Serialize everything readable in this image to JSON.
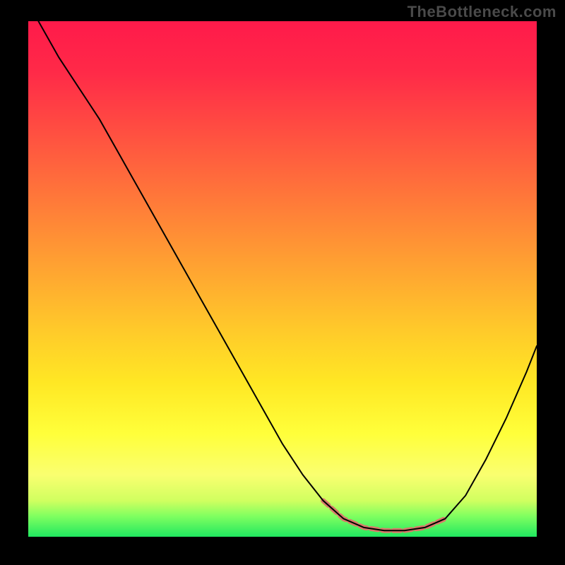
{
  "watermark": "TheBottleneck.com",
  "chart_data": {
    "type": "line",
    "title": "",
    "xlabel": "",
    "ylabel": "",
    "xlim": [
      0,
      100
    ],
    "ylim": [
      0,
      100
    ],
    "gradient_stops": [
      {
        "offset": 0,
        "color": "#ff1a4a"
      },
      {
        "offset": 10,
        "color": "#ff2a48"
      },
      {
        "offset": 20,
        "color": "#ff4a42"
      },
      {
        "offset": 30,
        "color": "#ff6a3c"
      },
      {
        "offset": 40,
        "color": "#ff8a36"
      },
      {
        "offset": 50,
        "color": "#ffaa30"
      },
      {
        "offset": 60,
        "color": "#ffca2a"
      },
      {
        "offset": 70,
        "color": "#ffe724"
      },
      {
        "offset": 80,
        "color": "#ffff3a"
      },
      {
        "offset": 88,
        "color": "#faff70"
      },
      {
        "offset": 93,
        "color": "#d0ff60"
      },
      {
        "offset": 96,
        "color": "#80ff60"
      },
      {
        "offset": 100,
        "color": "#20e860"
      }
    ],
    "series": [
      {
        "name": "curve",
        "color": "#000000",
        "width": 2,
        "points": [
          {
            "x": 2,
            "y": 100
          },
          {
            "x": 6,
            "y": 93
          },
          {
            "x": 10,
            "y": 87
          },
          {
            "x": 14,
            "y": 81
          },
          {
            "x": 18,
            "y": 74
          },
          {
            "x": 22,
            "y": 67
          },
          {
            "x": 26,
            "y": 60
          },
          {
            "x": 30,
            "y": 53
          },
          {
            "x": 34,
            "y": 46
          },
          {
            "x": 38,
            "y": 39
          },
          {
            "x": 42,
            "y": 32
          },
          {
            "x": 46,
            "y": 25
          },
          {
            "x": 50,
            "y": 18
          },
          {
            "x": 54,
            "y": 12
          },
          {
            "x": 58,
            "y": 7
          },
          {
            "x": 62,
            "y": 3.5
          },
          {
            "x": 66,
            "y": 1.8
          },
          {
            "x": 70,
            "y": 1.2
          },
          {
            "x": 74,
            "y": 1.2
          },
          {
            "x": 78,
            "y": 1.8
          },
          {
            "x": 82,
            "y": 3.5
          },
          {
            "x": 86,
            "y": 8
          },
          {
            "x": 90,
            "y": 15
          },
          {
            "x": 94,
            "y": 23
          },
          {
            "x": 98,
            "y": 32
          },
          {
            "x": 100,
            "y": 37
          }
        ]
      },
      {
        "name": "highlight",
        "color": "#d87a6a",
        "width": 7,
        "dash": "10,6",
        "points": [
          {
            "x": 58,
            "y": 7
          },
          {
            "x": 62,
            "y": 3.5
          },
          {
            "x": 66,
            "y": 1.8
          },
          {
            "x": 70,
            "y": 1.2
          },
          {
            "x": 74,
            "y": 1.2
          },
          {
            "x": 78,
            "y": 1.8
          },
          {
            "x": 82,
            "y": 3.5
          }
        ]
      }
    ]
  }
}
